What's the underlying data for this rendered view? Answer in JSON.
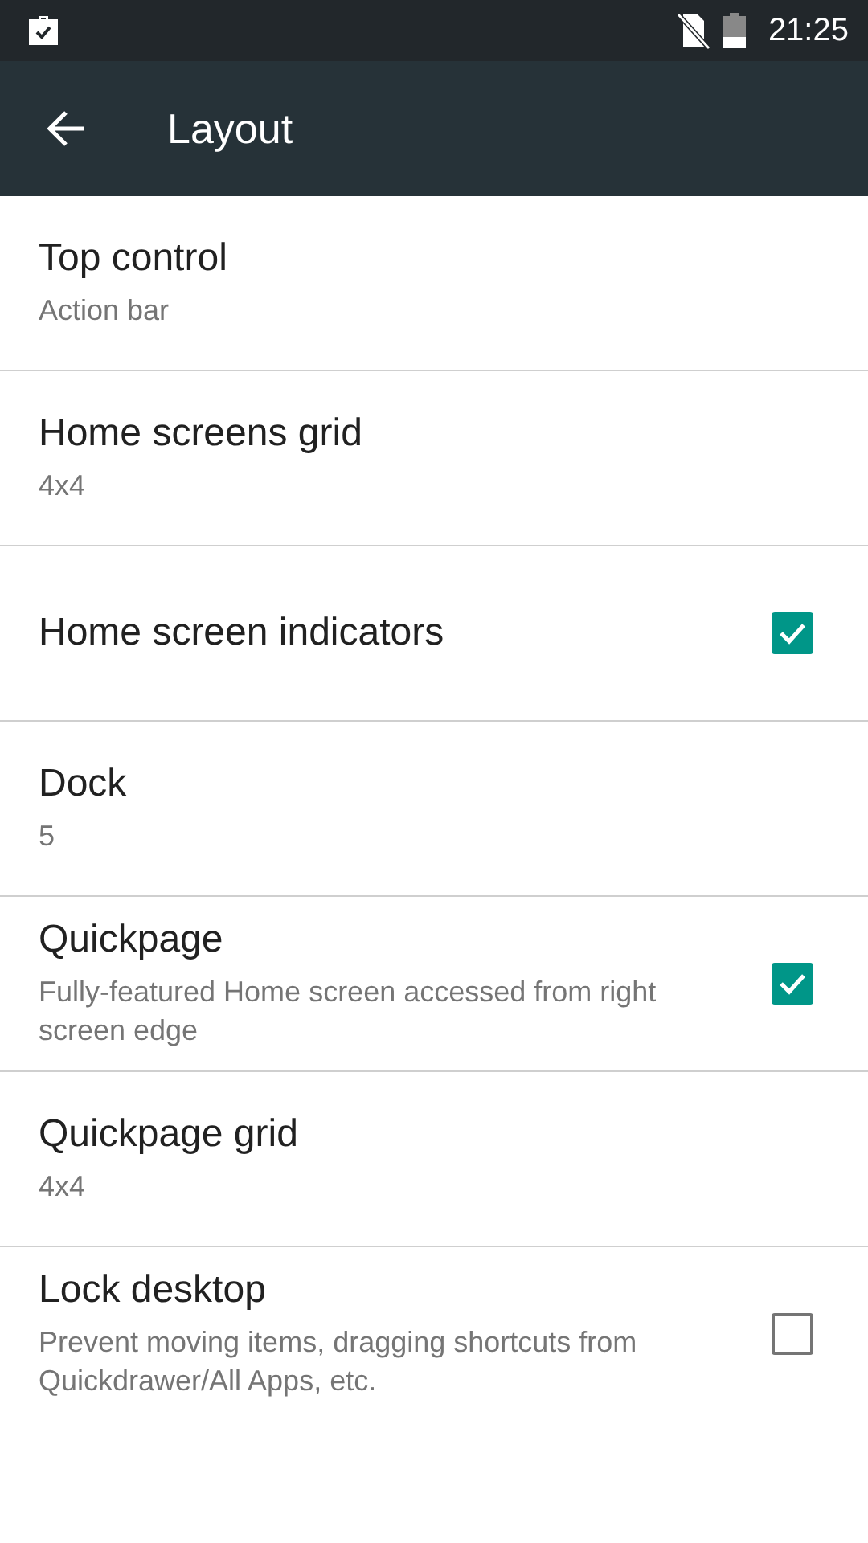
{
  "status_bar": {
    "time": "21:25"
  },
  "app_bar": {
    "title": "Layout"
  },
  "settings": [
    {
      "kind": "value",
      "title": "Top control",
      "summary": "Action bar"
    },
    {
      "kind": "value",
      "title": "Home screens grid",
      "summary": "4x4"
    },
    {
      "kind": "checkbox",
      "title": "Home screen indicators",
      "checked": true
    },
    {
      "kind": "value",
      "title": "Dock",
      "summary": "5"
    },
    {
      "kind": "checkbox",
      "title": "Quickpage",
      "summary": "Fully-featured Home screen accessed from right screen edge",
      "checked": true
    },
    {
      "kind": "value",
      "title": "Quickpage grid",
      "summary": "4x4"
    },
    {
      "kind": "checkbox",
      "title": "Lock desktop",
      "summary": "Prevent moving items, dragging shortcuts from Quickdrawer/All Apps, etc.",
      "checked": false
    }
  ]
}
